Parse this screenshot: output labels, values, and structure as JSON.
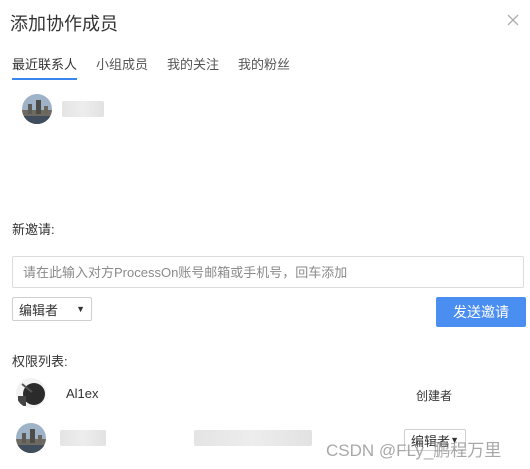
{
  "dialog": {
    "title": "添加协作成员",
    "close_icon": "close-icon"
  },
  "tabs": [
    {
      "label": "最近联系人",
      "active": true
    },
    {
      "label": "小组成员",
      "active": false
    },
    {
      "label": "我的关注",
      "active": false
    },
    {
      "label": "我的粉丝",
      "active": false
    }
  ],
  "recent_contacts": [
    {
      "avatar": "avatar-photo",
      "name_hidden": true
    }
  ],
  "invite": {
    "label": "新邀请:",
    "input_placeholder": "请在此输入对方ProcessOn账号邮箱或手机号，回车添加",
    "input_value": "",
    "role_select": "编辑者",
    "send_button": "发送邀请"
  },
  "permissions": {
    "label": "权限列表:",
    "rows": [
      {
        "name": "Al1ex",
        "role": "创建者",
        "avatar": "avatar-dark"
      },
      {
        "name": "",
        "name_hidden": true,
        "role_select": "编辑者",
        "avatar": "avatar-photo"
      }
    ]
  },
  "watermark": "CSDN @FLy_鹏程万里",
  "colors": {
    "accent": "#4a8ef2",
    "tab_underline": "#3a86f0",
    "text": "#333333"
  }
}
